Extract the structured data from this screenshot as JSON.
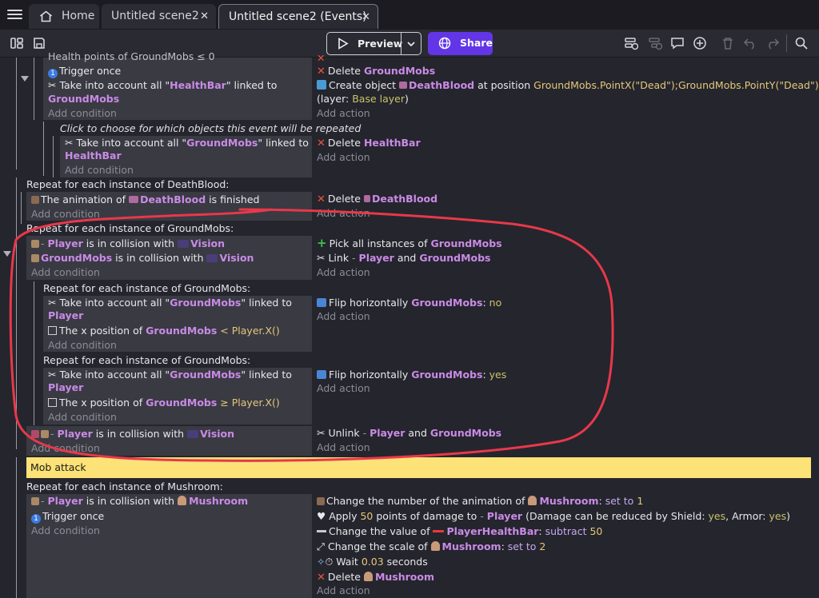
{
  "tabs": [
    {
      "label": "Home"
    },
    {
      "label": "Untitled scene2"
    },
    {
      "label": "Untitled scene2 (Events)"
    }
  ],
  "toolbar": {
    "preview_label": "Preview",
    "share_label": "Share"
  },
  "colors": {
    "accent": "#6236e6",
    "object": "#c98be6",
    "comment_bg": "#fce277",
    "delete_icon": "#e8563c",
    "annotation_circle": "#e8384a"
  },
  "add_condition": "Add condition",
  "add_action": "Add action",
  "events": {
    "e0": {
      "top_cut": "Health points of GroundMobs ≤ 0",
      "cond_trigger": "Trigger once",
      "cond_take_pre": "Take into account all \"",
      "cond_take_obj": "HealthBar",
      "cond_take_post": "\" linked to",
      "cond_take_target": "GroundMobs",
      "act_delete_label": "Delete",
      "act_delete_obj": "GroundMobs",
      "act_create_label": "Create object",
      "act_create_obj": "DeathBlood",
      "act_create_mid": "at position",
      "act_create_pos": "GroundMobs.PointX(\"Dead\");GroundMobs.PointY(\"Dead\")",
      "act_create_layer_pre": "(layer:",
      "act_create_layer": "Base layer",
      "act_create_layer_post": ")"
    },
    "e0_sub": {
      "hint": "Click to choose for which objects this event will be repeated",
      "cond_take_pre": "Take into account all \"",
      "cond_take_obj": "GroundMobs",
      "cond_take_post": "\" linked to",
      "cond_take_target": "HealthBar",
      "act_delete_label": "Delete",
      "act_delete_obj": "HealthBar"
    },
    "e1": {
      "header": "Repeat for each instance of DeathBlood:",
      "cond_pre": "The animation of",
      "cond_obj": "DeathBlood",
      "cond_post": "is finished",
      "act_delete_label": "Delete",
      "act_delete_obj": "DeathBlood"
    },
    "e2": {
      "header": "Repeat for each instance of GroundMobs:",
      "cond1_obj": "Player",
      "cond1_mid": "is in collision with",
      "cond1_target": "Vision",
      "cond2_obj": "GroundMobs",
      "cond2_mid": "is in collision with",
      "cond2_target": "Vision",
      "act_pick_label": "Pick all instances of",
      "act_pick_obj": "GroundMobs",
      "act_link_label": "Link",
      "act_link_obj1": "Player",
      "act_link_and": "and",
      "act_link_obj2": "GroundMobs"
    },
    "e2_sub1": {
      "header": "Repeat for each instance of GroundMobs:",
      "cond_take_pre": "Take into account all \"",
      "cond_take_obj": "GroundMobs",
      "cond_take_post": "\" linked to",
      "cond_take_target": "Player",
      "cond_x_pre": "The x position of",
      "cond_x_obj": "GroundMobs",
      "cond_x_op": "<",
      "cond_x_val": "Player.X()",
      "act_flip_label": "Flip horizontally",
      "act_flip_obj": "GroundMobs",
      "act_flip_colon": ":",
      "act_flip_val": "no"
    },
    "e2_sub2": {
      "header": "Repeat for each instance of GroundMobs:",
      "cond_take_pre": "Take into account all \"",
      "cond_take_obj": "GroundMobs",
      "cond_take_post": "\" linked to",
      "cond_take_target": "Player",
      "cond_x_pre": "The x position of",
      "cond_x_obj": "GroundMobs",
      "cond_x_op": "≥",
      "cond_x_val": "Player.X()",
      "act_flip_label": "Flip horizontally",
      "act_flip_obj": "GroundMobs",
      "act_flip_colon": ":",
      "act_flip_val": "yes"
    },
    "e3": {
      "cond_obj": "Player",
      "cond_mid": "is in collision with",
      "cond_target": "Vision",
      "act_unlink_label": "Unlink",
      "act_unlink_obj1": "Player",
      "act_unlink_and": "and",
      "act_unlink_obj2": "GroundMobs"
    },
    "comment": "Mob attack",
    "e4": {
      "header": "Repeat for each instance of Mushroom:",
      "cond_obj": "Player",
      "cond_mid": "is in collision with",
      "cond_target": "Mushroom",
      "cond_trigger": "Trigger once",
      "a1_pre": "Change the number of the animation of",
      "a1_obj": "Mushroom",
      "a1_colon": ":",
      "a1_op": "set to",
      "a1_val": "1",
      "a2_pre": "Apply",
      "a2_val": "50",
      "a2_mid": "points of damage to",
      "a2_obj": "Player",
      "a2_post1": "(Damage can be reduced by Shield:",
      "a2_shield": "yes",
      "a2_post2": ", Armor:",
      "a2_armor": "yes",
      "a2_post3": ")",
      "a3_pre": "Change the value of",
      "a3_obj": "PlayerHealthBar",
      "a3_colon": ":",
      "a3_op": "subtract",
      "a3_val": "50",
      "a4_pre": "Change the scale of",
      "a4_obj": "Mushroom",
      "a4_colon": ":",
      "a4_op": "set to",
      "a4_val": "2",
      "a5_pre": "Wait",
      "a5_val": "0.03",
      "a5_post": "seconds",
      "a6_label": "Delete",
      "a6_obj": "Mushroom"
    }
  }
}
